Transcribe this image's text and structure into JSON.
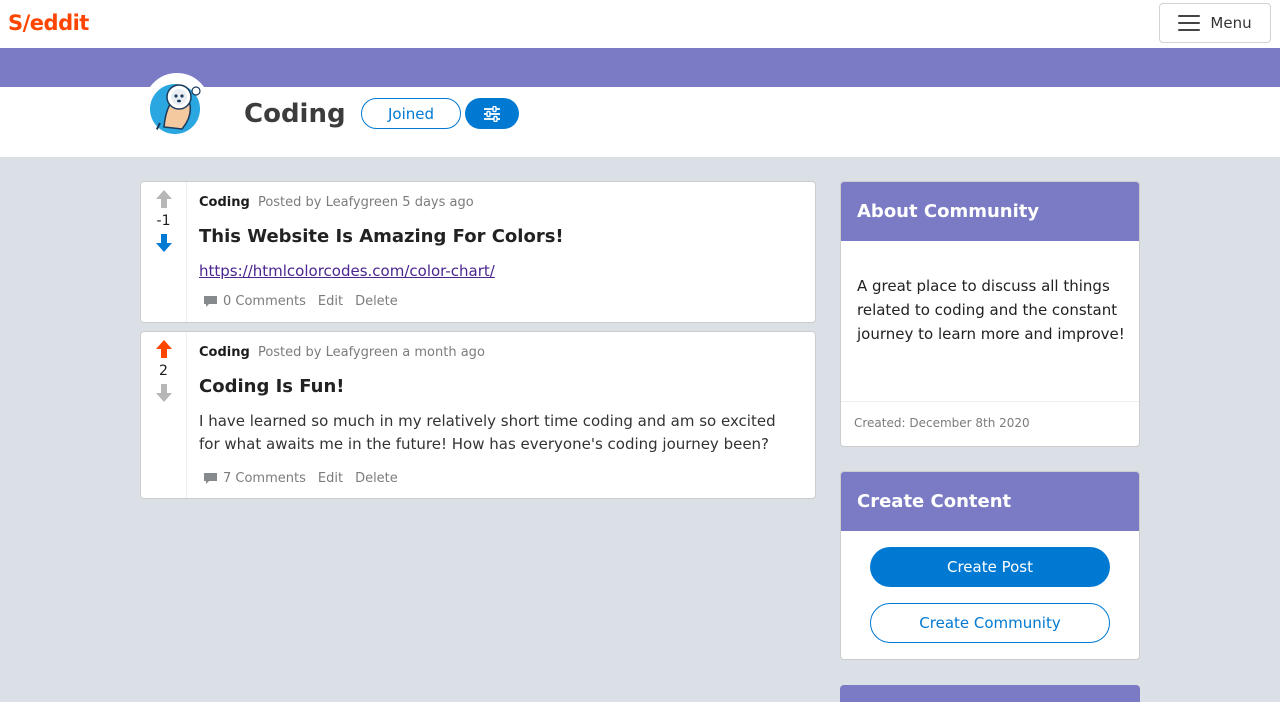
{
  "nav": {
    "logo": "S/eddit",
    "menu_label": "Menu"
  },
  "community": {
    "name": "Coding",
    "joined_label": "Joined"
  },
  "posts": [
    {
      "subreddit": "Coding",
      "posted_by": "Posted by Leafygreen 5 days ago",
      "score": "-1",
      "vote_state": "down",
      "title": "This Website Is Amazing For Colors!",
      "link": "https://htmlcolorcodes.com/color-chart/",
      "comments": "0 Comments",
      "edit": "Edit",
      "delete": "Delete"
    },
    {
      "subreddit": "Coding",
      "posted_by": "Posted by Leafygreen a month ago",
      "score": "2",
      "vote_state": "up",
      "title": "Coding Is Fun!",
      "text": "I have learned so much in my relatively short time coding and am so excited for what awaits me in the future! How has everyone's coding journey been?",
      "comments": "7 Comments",
      "edit": "Edit",
      "delete": "Delete"
    }
  ],
  "about": {
    "title": "About Community",
    "description": "A great place to discuss all things related to coding and the constant journey to learn more and improve!",
    "created": "Created: December 8th 2020"
  },
  "create": {
    "title": "Create Content",
    "post_label": "Create Post",
    "community_label": "Create Community"
  },
  "colors": {
    "brand": "#ff4500",
    "accent": "#0079d3",
    "banner": "#7a7bc4",
    "upvote": "#ff4500",
    "downvote": "#0079d3"
  }
}
